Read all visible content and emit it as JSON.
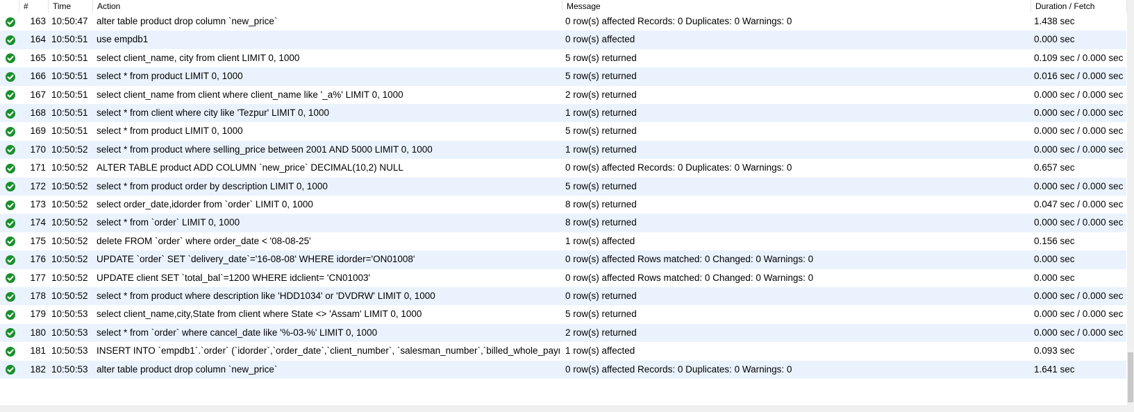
{
  "header": {
    "num": "#",
    "time": "Time",
    "action": "Action",
    "message": "Message",
    "duration": "Duration / Fetch"
  },
  "rows": [
    {
      "num": "163",
      "time": "10:50:47",
      "action": "alter table product drop column `new_price`",
      "message": "0 row(s) affected Records: 0  Duplicates: 0  Warnings: 0",
      "duration": "1.438 sec",
      "status": "success"
    },
    {
      "num": "164",
      "time": "10:50:51",
      "action": "use empdb1",
      "message": "0 row(s) affected",
      "duration": "0.000 sec",
      "status": "success"
    },
    {
      "num": "165",
      "time": "10:50:51",
      "action": "select client_name, city from client LIMIT 0, 1000",
      "message": "5 row(s) returned",
      "duration": "0.109 sec / 0.000 sec",
      "status": "success"
    },
    {
      "num": "166",
      "time": "10:50:51",
      "action": "select * from product LIMIT 0, 1000",
      "message": "5 row(s) returned",
      "duration": "0.016 sec / 0.000 sec",
      "status": "success"
    },
    {
      "num": "167",
      "time": "10:50:51",
      "action": "select client_name from client where client_name like '_a%' LIMIT 0, 1000",
      "message": "2 row(s) returned",
      "duration": "0.000 sec / 0.000 sec",
      "status": "success"
    },
    {
      "num": "168",
      "time": "10:50:51",
      "action": "select * from client where city like 'Tezpur' LIMIT 0, 1000",
      "message": "1 row(s) returned",
      "duration": "0.000 sec / 0.000 sec",
      "status": "success"
    },
    {
      "num": "169",
      "time": "10:50:51",
      "action": "select * from product LIMIT 0, 1000",
      "message": "5 row(s) returned",
      "duration": "0.000 sec / 0.000 sec",
      "status": "success"
    },
    {
      "num": "170",
      "time": "10:50:52",
      "action": "select * from product where selling_price between 2001 AND 5000 LIMIT 0, 1000",
      "message": "1 row(s) returned",
      "duration": "0.000 sec / 0.000 sec",
      "status": "success"
    },
    {
      "num": "171",
      "time": "10:50:52",
      "action": "ALTER TABLE product ADD COLUMN `new_price` DECIMAL(10,2) NULL",
      "message": "0 row(s) affected Records: 0  Duplicates: 0  Warnings: 0",
      "duration": "0.657 sec",
      "status": "success"
    },
    {
      "num": "172",
      "time": "10:50:52",
      "action": "select * from product order by description LIMIT 0, 1000",
      "message": "5 row(s) returned",
      "duration": "0.000 sec / 0.000 sec",
      "status": "success"
    },
    {
      "num": "173",
      "time": "10:50:52",
      "action": "select order_date,idorder from `order` LIMIT 0, 1000",
      "message": "8 row(s) returned",
      "duration": "0.047 sec / 0.000 sec",
      "status": "success"
    },
    {
      "num": "174",
      "time": "10:50:52",
      "action": "select * from `order` LIMIT 0, 1000",
      "message": "8 row(s) returned",
      "duration": "0.000 sec / 0.000 sec",
      "status": "success"
    },
    {
      "num": "175",
      "time": "10:50:52",
      "action": "delete FROM `order` where order_date < '08-08-25'",
      "message": "1 row(s) affected",
      "duration": "0.156 sec",
      "status": "success"
    },
    {
      "num": "176",
      "time": "10:50:52",
      "action": "UPDATE `order` SET `delivery_date`='16-08-08' WHERE idorder='ON01008'",
      "message": "0 row(s) affected Rows matched: 0  Changed: 0  Warnings: 0",
      "duration": "0.000 sec",
      "status": "success"
    },
    {
      "num": "177",
      "time": "10:50:52",
      "action": "UPDATE client SET `total_bal`=1200 WHERE idclient= 'CN01003'",
      "message": "0 row(s) affected Rows matched: 0  Changed: 0  Warnings: 0",
      "duration": "0.000 sec",
      "status": "success"
    },
    {
      "num": "178",
      "time": "10:50:52",
      "action": "select * from product where description like 'HDD1034' or 'DVDRW' LIMIT 0, 1000",
      "message": "0 row(s) returned",
      "duration": "0.000 sec / 0.000 sec",
      "status": "success"
    },
    {
      "num": "179",
      "time": "10:50:53",
      "action": "select client_name,city,State from client where State <> 'Assam' LIMIT 0, 1000",
      "message": "5 row(s) returned",
      "duration": "0.000 sec / 0.000 sec",
      "status": "success"
    },
    {
      "num": "180",
      "time": "10:50:53",
      "action": "select * from `order` where cancel_date like '%-03-%' LIMIT 0, 1000",
      "message": "2 row(s) returned",
      "duration": "0.000 sec / 0.000 sec",
      "status": "success"
    },
    {
      "num": "181",
      "time": "10:50:53",
      "action": "INSERT INTO `empdb1`.`order` (`idorder`,`order_date`,`client_number`, `salesman_number`,`billed_whole_paym...",
      "message": "1 row(s) affected",
      "duration": "0.093 sec",
      "status": "success"
    },
    {
      "num": "182",
      "time": "10:50:53",
      "action": "alter table product drop column `new_price`",
      "message": "0 row(s) affected Records: 0  Duplicates: 0  Warnings: 0",
      "duration": "1.641 sec",
      "status": "success"
    }
  ],
  "colors": {
    "success": "#1a8f2d",
    "row_alt": "#eaf3fd"
  }
}
